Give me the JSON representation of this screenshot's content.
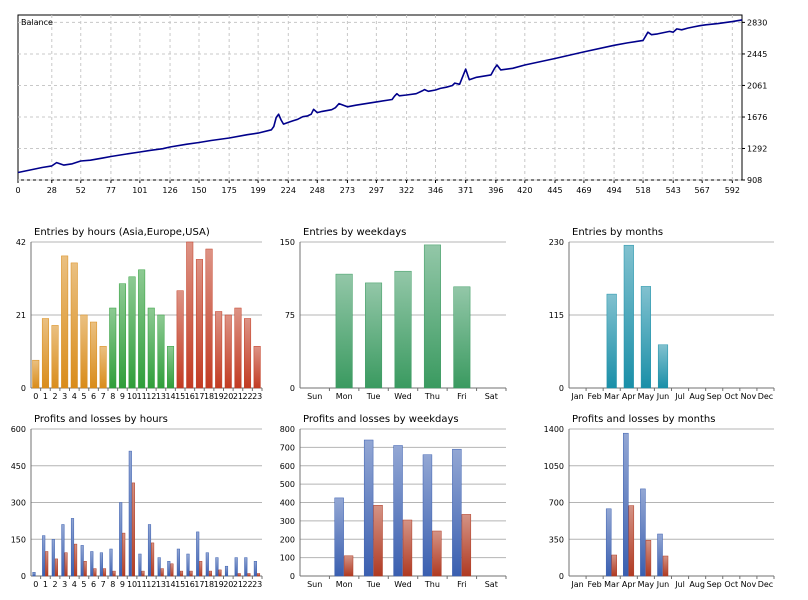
{
  "chart_data": [
    {
      "type": "line",
      "title": "Balance",
      "xticks": [
        0,
        28,
        52,
        77,
        101,
        126,
        150,
        175,
        199,
        224,
        248,
        273,
        297,
        322,
        346,
        371,
        396,
        420,
        445,
        469,
        494,
        518,
        543,
        567,
        592
      ],
      "yticks": [
        908,
        1292,
        1676,
        2061,
        2445,
        2830
      ],
      "xlim": [
        0,
        600
      ],
      "ylim": [
        908,
        2920
      ],
      "grid": true,
      "color": "#00008b",
      "x": [
        0,
        10,
        20,
        28,
        32,
        38,
        45,
        52,
        60,
        70,
        77,
        90,
        101,
        110,
        120,
        126,
        140,
        150,
        160,
        175,
        190,
        199,
        210,
        212,
        214,
        216,
        218,
        220,
        224,
        228,
        232,
        236,
        240,
        243,
        245,
        248,
        252,
        260,
        263,
        266,
        273,
        280,
        297,
        310,
        312,
        314,
        316,
        322,
        330,
        335,
        337,
        340,
        346,
        350,
        355,
        360,
        362,
        366,
        368,
        371,
        374,
        380,
        392,
        395,
        397,
        400,
        410,
        420,
        445,
        469,
        494,
        505,
        518,
        520,
        522,
        525,
        530,
        535,
        540,
        543,
        546,
        550,
        555,
        560,
        565,
        570,
        580,
        592,
        600
      ],
      "y": [
        1000,
        1030,
        1060,
        1080,
        1120,
        1090,
        1105,
        1140,
        1150,
        1175,
        1195,
        1225,
        1250,
        1270,
        1290,
        1310,
        1345,
        1365,
        1390,
        1420,
        1460,
        1480,
        1520,
        1560,
        1670,
        1710,
        1640,
        1590,
        1610,
        1630,
        1650,
        1680,
        1690,
        1710,
        1770,
        1730,
        1745,
        1765,
        1790,
        1840,
        1800,
        1820,
        1860,
        1890,
        1930,
        1960,
        1935,
        1945,
        1960,
        1995,
        2010,
        1990,
        2005,
        2025,
        2040,
        2060,
        2090,
        2075,
        2150,
        2260,
        2130,
        2160,
        2190,
        2270,
        2310,
        2250,
        2270,
        2310,
        2390,
        2470,
        2550,
        2580,
        2610,
        2660,
        2710,
        2680,
        2690,
        2705,
        2720,
        2710,
        2750,
        2740,
        2760,
        2775,
        2790,
        2800,
        2815,
        2840,
        2860
      ]
    },
    {
      "type": "bar",
      "title": "Entries by hours (Asia,Europe,USA)",
      "categories": [
        "0",
        "1",
        "2",
        "3",
        "4",
        "5",
        "6",
        "7",
        "8",
        "9",
        "10",
        "11",
        "12",
        "13",
        "14",
        "15",
        "16",
        "17",
        "18",
        "19",
        "20",
        "21",
        "22",
        "23"
      ],
      "values": [
        8,
        20,
        18,
        38,
        36,
        21,
        19,
        12,
        23,
        30,
        32,
        34,
        23,
        21,
        12,
        28,
        42,
        37,
        40,
        22,
        21,
        23,
        20,
        12
      ],
      "yticks": [
        0,
        21,
        42
      ],
      "ylim": [
        0,
        42
      ],
      "colors": [
        "#d98c1a",
        "#d98c1a",
        "#d98c1a",
        "#d98c1a",
        "#d98c1a",
        "#d98c1a",
        "#d98c1a",
        "#d98c1a",
        "#2f9e3a",
        "#2f9e3a",
        "#2f9e3a",
        "#2f9e3a",
        "#2f9e3a",
        "#2f9e3a",
        "#2f9e3a",
        "#c23b22",
        "#c23b22",
        "#c23b22",
        "#c23b22",
        "#c23b22",
        "#c23b22",
        "#c23b22",
        "#c23b22",
        "#c23b22"
      ]
    },
    {
      "type": "bar",
      "title": "Entries by weekdays",
      "categories": [
        "Sun",
        "Mon",
        "Tue",
        "Wed",
        "Thu",
        "Fri",
        "Sat"
      ],
      "values": [
        0,
        117,
        108,
        120,
        147,
        104,
        0
      ],
      "yticks": [
        0,
        75,
        150
      ],
      "ylim": [
        0,
        150
      ],
      "colors": [
        "#3a9a60"
      ]
    },
    {
      "type": "bar",
      "title": "Entries by months",
      "categories": [
        "Jan",
        "Feb",
        "Mar",
        "Apr",
        "May",
        "Jun",
        "Jul",
        "Aug",
        "Sep",
        "Oct",
        "Nov",
        "Dec"
      ],
      "values": [
        0,
        0,
        148,
        225,
        160,
        68,
        0,
        0,
        0,
        0,
        0,
        0
      ],
      "yticks": [
        0,
        115,
        230
      ],
      "ylim": [
        0,
        230
      ],
      "colors": [
        "#1a8fa8"
      ]
    },
    {
      "type": "bar",
      "title": "Profits and losses by hours",
      "categories": [
        "0",
        "1",
        "2",
        "3",
        "4",
        "5",
        "6",
        "7",
        "8",
        "9",
        "10",
        "11",
        "12",
        "13",
        "14",
        "15",
        "16",
        "17",
        "18",
        "19",
        "20",
        "21",
        "22",
        "23"
      ],
      "series": [
        {
          "values": [
            15,
            165,
            150,
            210,
            235,
            125,
            100,
            95,
            110,
            300,
            510,
            90,
            210,
            75,
            60,
            110,
            90,
            180,
            95,
            75,
            40,
            75,
            75,
            60
          ],
          "color": "#3a5fb0"
        },
        {
          "values": [
            0,
            100,
            70,
            95,
            130,
            60,
            30,
            30,
            20,
            175,
            380,
            20,
            135,
            30,
            50,
            20,
            20,
            60,
            20,
            25,
            0,
            10,
            10,
            10
          ],
          "color": "#b03a22"
        }
      ],
      "yticks": [
        0,
        150,
        300,
        450,
        600
      ],
      "ylim": [
        0,
        600
      ]
    },
    {
      "type": "bar",
      "title": "Profits and losses by weekdays",
      "categories": [
        "Sun",
        "Mon",
        "Tue",
        "Wed",
        "Thu",
        "Fri",
        "Sat"
      ],
      "series": [
        {
          "values": [
            0,
            425,
            740,
            710,
            660,
            690,
            0
          ],
          "color": "#3a5fb0"
        },
        {
          "values": [
            0,
            110,
            385,
            305,
            245,
            335,
            0
          ],
          "color": "#b03a22"
        }
      ],
      "yticks": [
        0,
        100,
        200,
        300,
        400,
        500,
        600,
        700,
        800
      ],
      "ylim": [
        0,
        800
      ]
    },
    {
      "type": "bar",
      "title": "Profits and losses by months",
      "categories": [
        "Jan",
        "Feb",
        "Mar",
        "Apr",
        "May",
        "Jun",
        "Jul",
        "Aug",
        "Sep",
        "Oct",
        "Nov",
        "Dec"
      ],
      "series": [
        {
          "values": [
            0,
            0,
            640,
            1360,
            830,
            400,
            0,
            0,
            0,
            0,
            0,
            0
          ],
          "color": "#3a5fb0"
        },
        {
          "values": [
            0,
            0,
            200,
            670,
            340,
            190,
            0,
            0,
            0,
            0,
            0,
            0
          ],
          "color": "#b03a22"
        }
      ],
      "yticks": [
        0,
        350,
        700,
        1050,
        1400
      ],
      "ylim": [
        0,
        1400
      ]
    }
  ]
}
